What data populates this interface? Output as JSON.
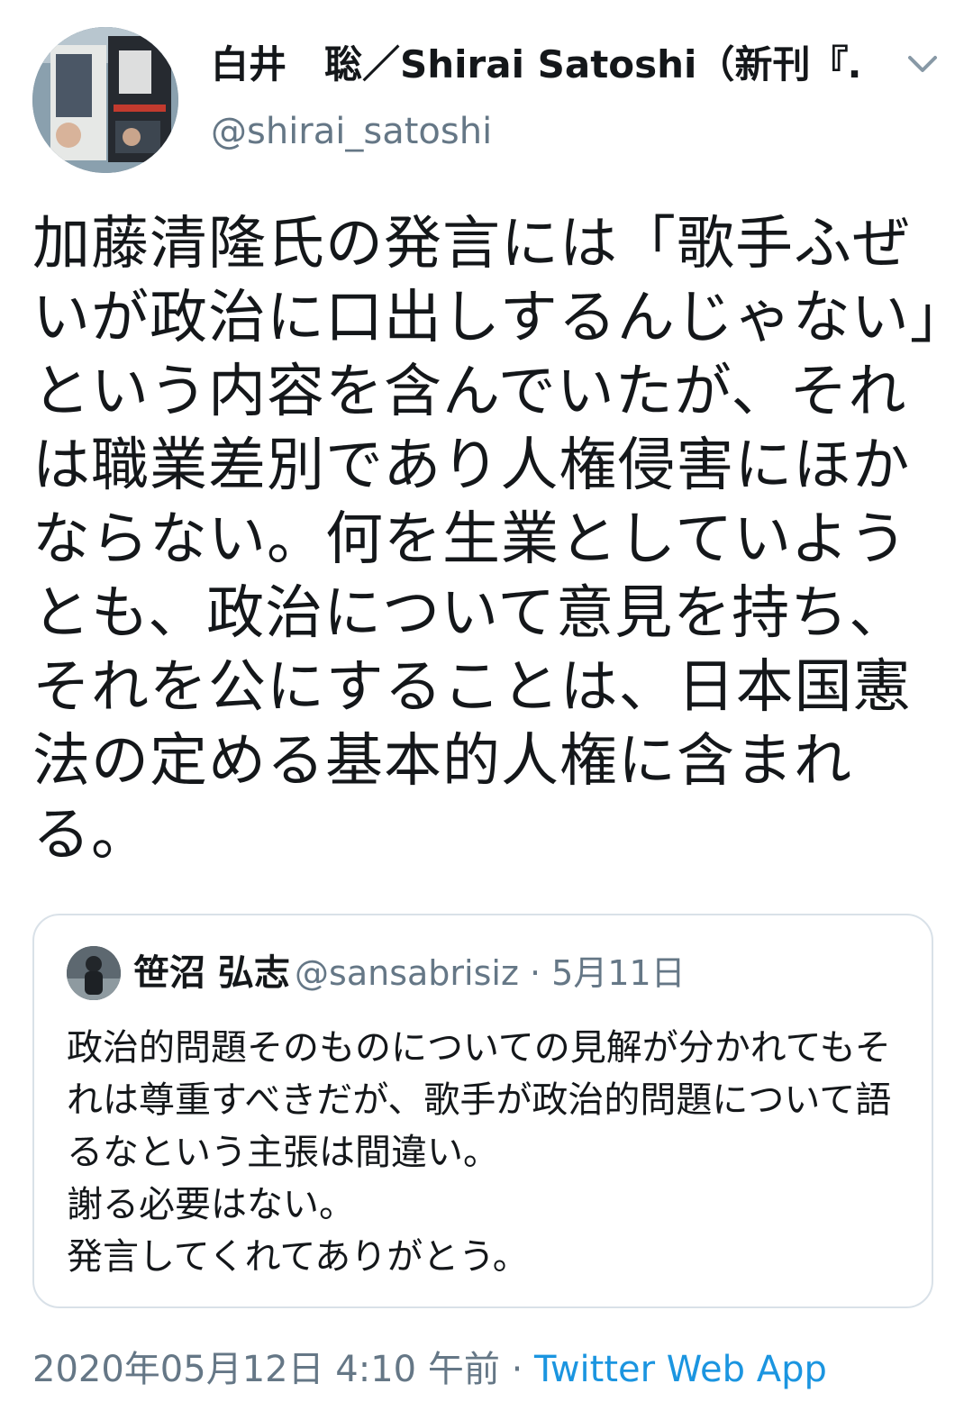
{
  "author": {
    "display_name": "白井　聡／Shirai Satoshi（新刊『…",
    "handle": "@shirai_satoshi",
    "avatar_icon": "book-cover-avatar-icon"
  },
  "menu_icon": "chevron-down-icon",
  "tweet_text": "加藤清隆氏の発言には「歌手ふぜいが政治に口出しするんじゃない」という内容を含んでいたが、それは職業差別であり人権侵害にほかならない。何を生業としていようとも、政治について意見を持ち、それを公にすることは、日本国憲法の定める基本的人権に含まれる。",
  "quote": {
    "name": "笹沼 弘志",
    "handle": "@sansabrisiz",
    "separator": " · ",
    "date": "5月11日",
    "text": "政治的問題そのものについての見解が分かれてもそれは尊重すべきだが、歌手が政治的問題について語るなという主張は間違い。\n謝る必要はない。\n発言してくれてありがとう。"
  },
  "footer": {
    "timestamp": "2020年05月12日 4:10 午前",
    "separator": " · ",
    "source": "Twitter Web App"
  },
  "colors": {
    "text": "#14171a",
    "secondary": "#657786",
    "link": "#1b95e0",
    "border": "#d9e1e8"
  }
}
